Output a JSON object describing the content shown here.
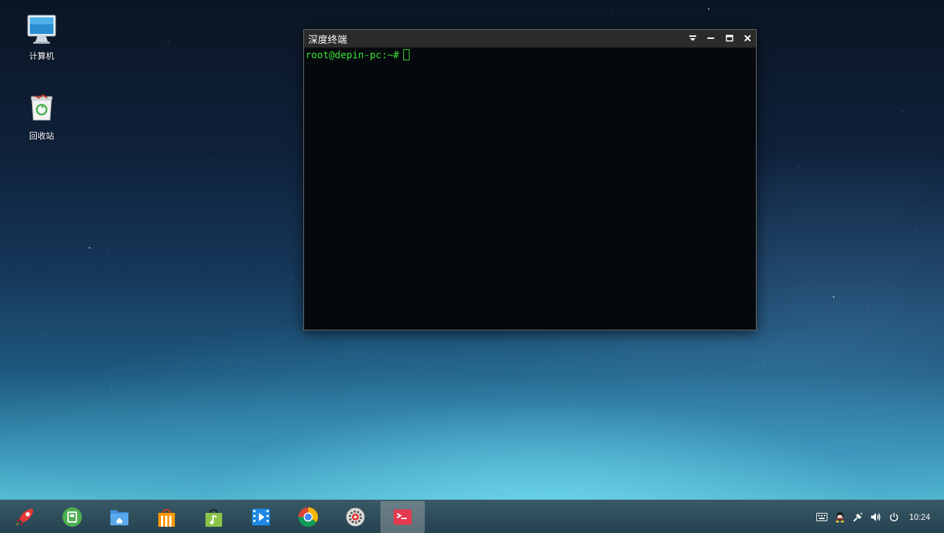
{
  "desktop": {
    "icons": [
      {
        "label": "计算机",
        "icon": "computer-icon"
      },
      {
        "label": "回收站",
        "icon": "trash-icon"
      }
    ]
  },
  "terminal": {
    "title": "深度终端",
    "prompt": "root@depin-pc:~#",
    "buttons": {
      "menu": "menu-icon",
      "minimize": "minimize-icon",
      "maximize": "maximize-icon",
      "close": "close-icon"
    }
  },
  "taskbar": {
    "apps": [
      {
        "name": "launcher",
        "icon": "rocket-icon"
      },
      {
        "name": "screen-capture",
        "icon": "screenshot-icon"
      },
      {
        "name": "file-manager",
        "icon": "folder-icon"
      },
      {
        "name": "app-store",
        "icon": "store-bag-icon"
      },
      {
        "name": "music",
        "icon": "music-bag-icon"
      },
      {
        "name": "video",
        "icon": "video-player-icon"
      },
      {
        "name": "browser",
        "icon": "chrome-icon"
      },
      {
        "name": "settings",
        "icon": "settings-gear-icon"
      },
      {
        "name": "terminal",
        "icon": "terminal-icon",
        "active": true
      }
    ],
    "tray": [
      "keyboard-icon",
      "qq-icon",
      "network-icon",
      "volume-icon",
      "power-icon"
    ],
    "clock": "10:24"
  }
}
